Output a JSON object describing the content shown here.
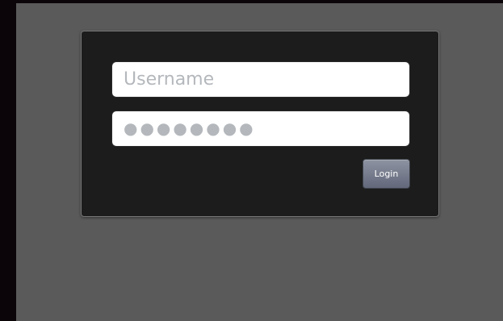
{
  "login_form": {
    "username_placeholder": "Username",
    "password_placeholder": "●●●●●●●●",
    "login_label": "Login"
  },
  "colors": {
    "page_background": "#5a5a5a",
    "panel_background": "#1c1c1c",
    "button_top": "#8d93a1",
    "button_bottom": "#62687a"
  }
}
